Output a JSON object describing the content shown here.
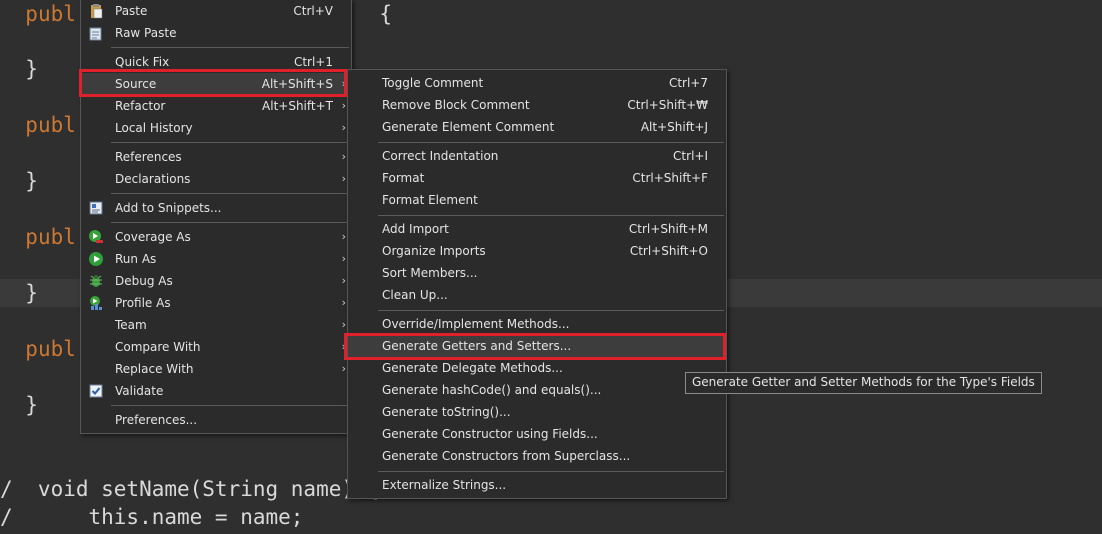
{
  "editor": {
    "lines": [
      {
        "kw": "publ",
        "rest": "",
        "extra": "{"
      },
      {
        "kw": "",
        "rest": "}"
      },
      {
        "kw": "publ",
        "rest": ""
      },
      {
        "kw": "",
        "rest": "}"
      },
      {
        "kw": "publ",
        "rest": ""
      },
      {
        "kw": "",
        "rest": "}"
      },
      {
        "kw": "publ",
        "rest": ""
      },
      {
        "kw": "",
        "rest": "}"
      }
    ],
    "bottom_line_1": "/  void setName(String name) {",
    "bottom_line_2": "/      this.name = name;"
  },
  "context_menu": {
    "paste": {
      "label": "Paste",
      "shortcut": "Ctrl+V"
    },
    "raw_paste": {
      "label": "Raw Paste"
    },
    "quick_fix": {
      "label": "Quick Fix",
      "shortcut": "Ctrl+1"
    },
    "source": {
      "label": "Source",
      "shortcut": "Alt+Shift+S"
    },
    "refactor": {
      "label": "Refactor",
      "shortcut": "Alt+Shift+T"
    },
    "local_history": {
      "label": "Local History"
    },
    "references": {
      "label": "References"
    },
    "declarations": {
      "label": "Declarations"
    },
    "add_to_snippets": {
      "label": "Add to Snippets..."
    },
    "coverage_as": {
      "label": "Coverage As"
    },
    "run_as": {
      "label": "Run As"
    },
    "debug_as": {
      "label": "Debug As"
    },
    "profile_as": {
      "label": "Profile As"
    },
    "team": {
      "label": "Team"
    },
    "compare_with": {
      "label": "Compare With"
    },
    "replace_with": {
      "label": "Replace With"
    },
    "validate": {
      "label": "Validate"
    },
    "preferences": {
      "label": "Preferences..."
    }
  },
  "source_submenu": {
    "toggle_comment": {
      "label": "Toggle Comment",
      "shortcut": "Ctrl+7"
    },
    "remove_block_comment": {
      "label": "Remove Block Comment",
      "shortcut": "Ctrl+Shift+₩"
    },
    "generate_element_comment": {
      "label": "Generate Element Comment",
      "shortcut": "Alt+Shift+J"
    },
    "correct_indentation": {
      "label": "Correct Indentation",
      "shortcut": "Ctrl+I"
    },
    "format": {
      "label": "Format",
      "shortcut": "Ctrl+Shift+F"
    },
    "format_element": {
      "label": "Format Element"
    },
    "add_import": {
      "label": "Add Import",
      "shortcut": "Ctrl+Shift+M"
    },
    "organize_imports": {
      "label": "Organize Imports",
      "shortcut": "Ctrl+Shift+O"
    },
    "sort_members": {
      "label": "Sort Members..."
    },
    "clean_up": {
      "label": "Clean Up..."
    },
    "override_implement": {
      "label": "Override/Implement Methods..."
    },
    "generate_getters_setters": {
      "label": "Generate Getters and Setters..."
    },
    "generate_delegate": {
      "label": "Generate Delegate Methods..."
    },
    "generate_hashcode_equals": {
      "label": "Generate hashCode() and equals()..."
    },
    "generate_tostring": {
      "label": "Generate toString()..."
    },
    "generate_constructor_fields": {
      "label": "Generate Constructor using Fields..."
    },
    "generate_constructors_superclass": {
      "label": "Generate Constructors from Superclass..."
    },
    "externalize_strings": {
      "label": "Externalize Strings..."
    }
  },
  "tooltip": {
    "text": "Generate Getter and Setter Methods for the Type's Fields"
  },
  "colors": {
    "highlight_border": "#e0202a",
    "menu_bg": "#2b2b2b",
    "editor_bg": "#2f2f2f",
    "keyword": "#cc7832"
  }
}
